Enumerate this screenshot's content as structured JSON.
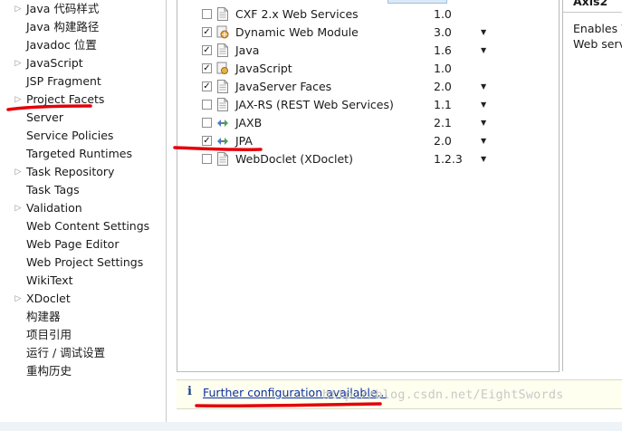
{
  "nav": {
    "items": [
      {
        "label": "Java 代码样式",
        "expandable": true
      },
      {
        "label": "Java 构建路径",
        "expandable": false
      },
      {
        "label": "Javadoc 位置",
        "expandable": false
      },
      {
        "label": "JavaScript",
        "expandable": true
      },
      {
        "label": "JSP Fragment",
        "expandable": false
      },
      {
        "label": "Project Facets",
        "expandable": true
      },
      {
        "label": "Server",
        "expandable": false
      },
      {
        "label": "Service Policies",
        "expandable": false
      },
      {
        "label": "Targeted Runtimes",
        "expandable": false
      },
      {
        "label": "Task Repository",
        "expandable": true
      },
      {
        "label": "Task Tags",
        "expandable": false
      },
      {
        "label": "Validation",
        "expandable": true
      },
      {
        "label": "Web Content Settings",
        "expandable": false
      },
      {
        "label": "Web Page Editor",
        "expandable": false
      },
      {
        "label": "Web Project Settings",
        "expandable": false
      },
      {
        "label": "WikiText",
        "expandable": false
      },
      {
        "label": "XDoclet",
        "expandable": true
      },
      {
        "label": "构建器",
        "expandable": false
      },
      {
        "label": "项目引用",
        "expandable": false
      },
      {
        "label": "运行 / 调试设置",
        "expandable": false
      },
      {
        "label": "重构历史",
        "expandable": false
      }
    ]
  },
  "facets": {
    "rows": [
      {
        "name": "CXF 2.x Web Services",
        "version": "1.0",
        "checked": false,
        "dropdown": false,
        "icon": "page-icon"
      },
      {
        "name": "Dynamic Web Module",
        "version": "3.0",
        "checked": true,
        "dropdown": true,
        "icon": "web-module-icon"
      },
      {
        "name": "Java",
        "version": "1.6",
        "checked": true,
        "dropdown": true,
        "icon": "page-icon"
      },
      {
        "name": "JavaScript",
        "version": "1.0",
        "checked": true,
        "dropdown": false,
        "icon": "javascript-icon"
      },
      {
        "name": "JavaServer Faces",
        "version": "2.0",
        "checked": true,
        "dropdown": true,
        "icon": "page-icon"
      },
      {
        "name": "JAX-RS (REST Web Services)",
        "version": "1.1",
        "checked": false,
        "dropdown": true,
        "icon": "page-icon"
      },
      {
        "name": "JAXB",
        "version": "2.1",
        "checked": false,
        "dropdown": true,
        "icon": "jaxb-icon"
      },
      {
        "name": "JPA",
        "version": "2.0",
        "checked": true,
        "dropdown": true,
        "icon": "jpa-icon"
      },
      {
        "name": "WebDoclet (XDoclet)",
        "version": "1.2.3",
        "checked": false,
        "dropdown": true,
        "icon": "page-icon"
      }
    ]
  },
  "description": {
    "title": "Axis2",
    "lines": [
      "Enables W",
      "Web serv"
    ]
  },
  "infobar": {
    "icon": "info-icon",
    "link": "Further configuration available..."
  },
  "watermark": "http://blog.csdn.net/EightSwords",
  "colors": {
    "annotation_red": "#e3000b",
    "link_blue": "#0b2f9c",
    "info_bg": "#fffff0"
  }
}
